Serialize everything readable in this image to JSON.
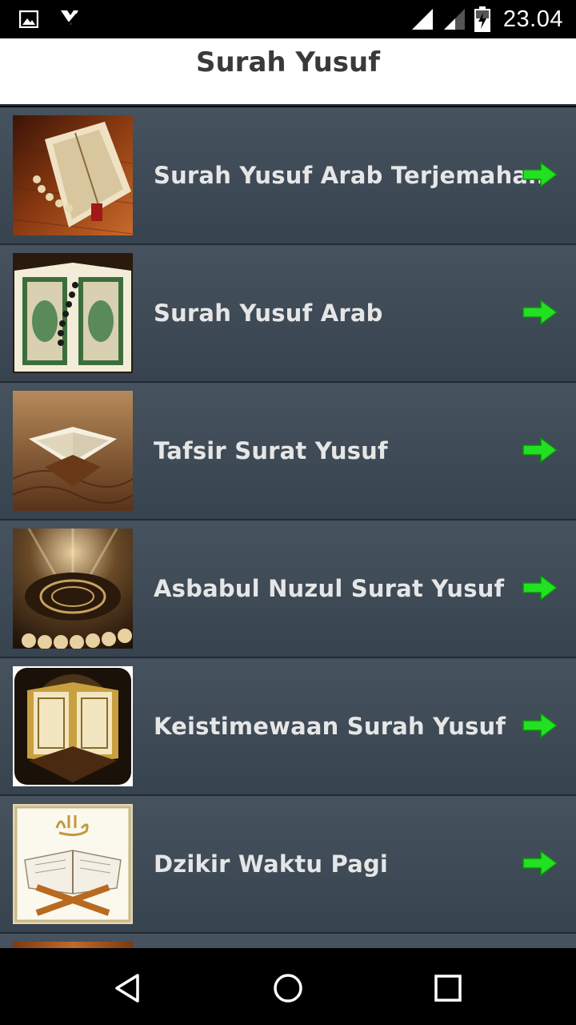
{
  "status_bar": {
    "time": "23.04",
    "icons": [
      "gallery-icon",
      "download-done-icon",
      "signal-full-icon",
      "signal-weak-icon",
      "battery-charging-icon"
    ]
  },
  "app_bar": {
    "title": "Surah Yusuf"
  },
  "list": {
    "items": [
      {
        "label": "Surah Yusuf Arab Terjemahan",
        "thumb": "quran-rosary-image"
      },
      {
        "label": "Surah Yusuf Arab",
        "thumb": "quran-open-green-image"
      },
      {
        "label": "Tafsir Surat Yusuf",
        "thumb": "quran-stand-image"
      },
      {
        "label": "Asbabul Nuzul Surat Yusuf",
        "thumb": "calligraphy-light-image"
      },
      {
        "label": "Keistimewaan Surah Yusuf",
        "thumb": "golden-quran-image"
      },
      {
        "label": "Dzikir Waktu Pagi",
        "thumb": "allah-quran-image"
      }
    ],
    "arrow_icon": "arrow-right-icon",
    "arrow_color": "#22e022"
  },
  "nav_bar": {
    "icons": [
      "back-icon",
      "home-icon",
      "recents-icon"
    ]
  }
}
